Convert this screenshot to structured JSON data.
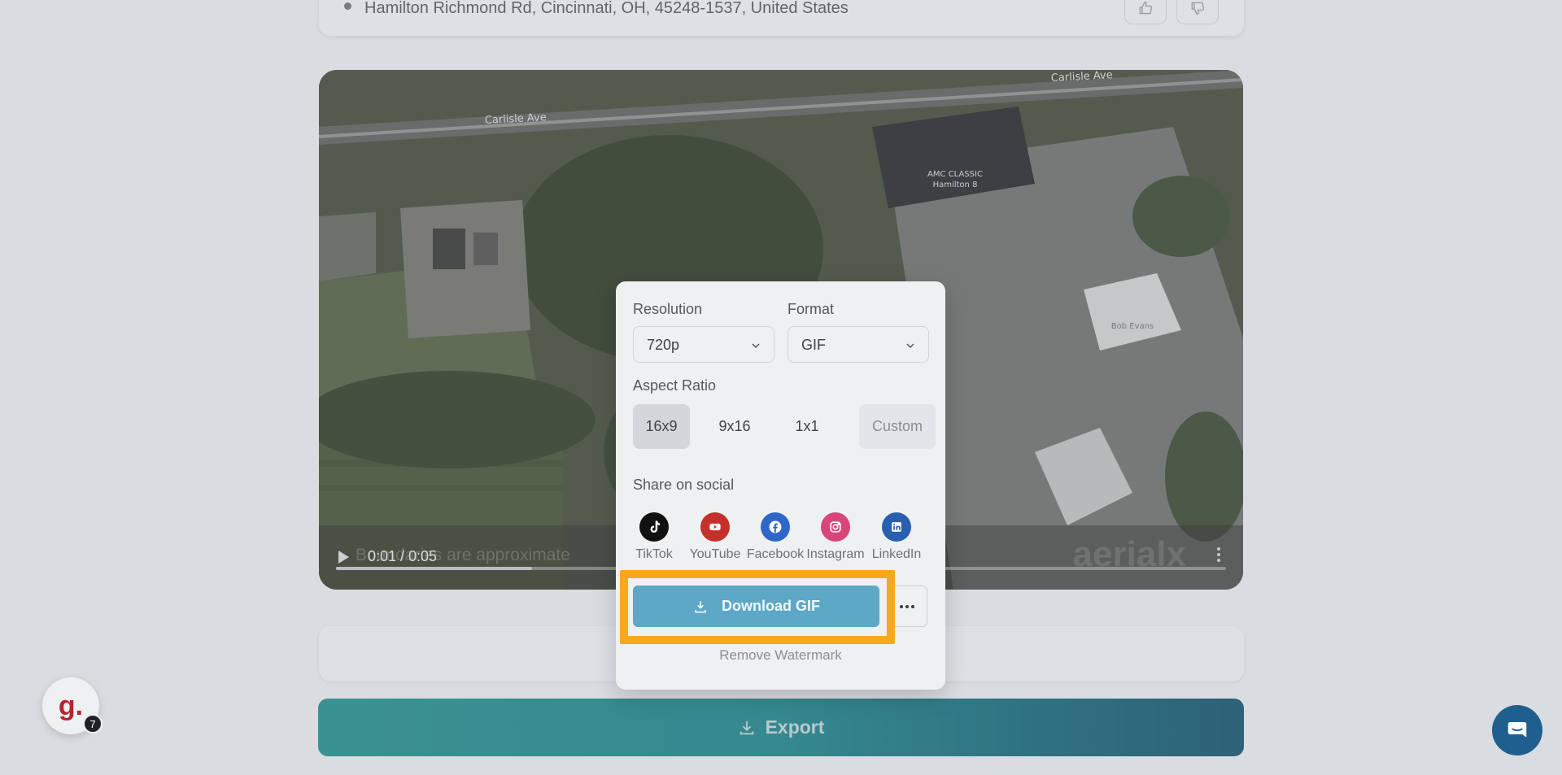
{
  "address": {
    "text": "Hamilton Richmond Rd, Cincinnati, OH, 45248-1537, United States",
    "like_icon": "thumbs-up-icon",
    "dislike_icon": "thumbs-down-icon"
  },
  "video": {
    "time": "0:01 / 0:05",
    "overlay_text": "Boundaries are approximate",
    "watermark": "aerialx",
    "progress": 0.22,
    "map_labels": {
      "road_left": "Carlisle Ave",
      "road_right": "Carlisle Ave",
      "cinema_line1": "AMC CLASSIC",
      "cinema_line2": "Hamilton 8",
      "restaurant": "Bob Evans"
    }
  },
  "export_popup": {
    "resolution_label": "Resolution",
    "resolution_value": "720p",
    "format_label": "Format",
    "format_value": "GIF",
    "aspect_label": "Aspect Ratio",
    "aspect_options": [
      "16x9",
      "9x16",
      "1x1",
      "Custom"
    ],
    "aspect_selected": "16x9",
    "share_label": "Share on social",
    "socials": [
      {
        "name": "TikTok",
        "icon": "tiktok-icon",
        "color": "#111111"
      },
      {
        "name": "YouTube",
        "icon": "youtube-icon",
        "color": "#c4302b"
      },
      {
        "name": "Facebook",
        "icon": "facebook-icon",
        "color": "#2f66c9"
      },
      {
        "name": "Instagram",
        "icon": "instagram-icon",
        "color": "#d9457a"
      },
      {
        "name": "LinkedIn",
        "icon": "linkedin-icon",
        "color": "#2a5fb0"
      }
    ],
    "download_label": "Download GIF",
    "remove_watermark": "Remove Watermark"
  },
  "export_button": {
    "label": "Export"
  },
  "badge": {
    "letter": "g.",
    "count": "7"
  },
  "colors": {
    "accent_highlight": "#f7a81b",
    "download_button": "#5ca8c6",
    "export_gradient_start": "#1c8a87",
    "export_gradient_end": "#0b4d66"
  }
}
